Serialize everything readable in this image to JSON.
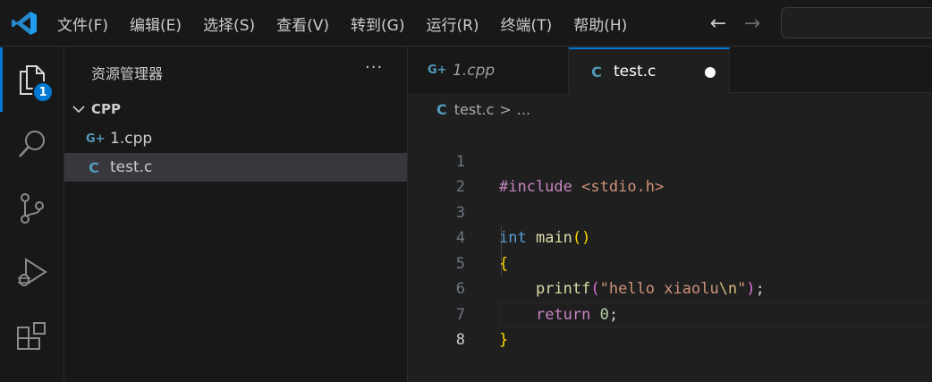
{
  "menu": [
    "文件(F)",
    "编辑(E)",
    "选择(S)",
    "查看(V)",
    "转到(G)",
    "运行(R)",
    "终端(T)",
    "帮助(H)"
  ],
  "activity": {
    "explorer_badge": "1",
    "items": [
      "explorer-icon",
      "search-icon",
      "source-control-icon",
      "run-debug-icon",
      "extensions-icon"
    ]
  },
  "sidebar": {
    "title": "资源管理器",
    "more": "···",
    "folder": "CPP",
    "files": [
      {
        "icon": "G+",
        "name": "1.cpp"
      },
      {
        "icon": "C",
        "name": "test.c"
      }
    ]
  },
  "tabs": [
    {
      "icon": "G+",
      "label": "1.cpp"
    },
    {
      "icon": "C",
      "label": "test.c"
    }
  ],
  "breadcrumb": {
    "icon": "C",
    "file": "test.c",
    "sep": ">",
    "more": "..."
  },
  "editor": {
    "line_numbers": [
      "1",
      "2",
      "3",
      "4",
      "5",
      "6",
      "7",
      "8"
    ],
    "code": {
      "l1_directive": "#include",
      "l1_header": "<stdio.h>",
      "l3_type": "int",
      "l3_fn": "main",
      "l3_parens": "()",
      "l4_brace": "{",
      "l5_indent": "    ",
      "l5_fn": "printf",
      "l5_open": "(",
      "l5_str_a": "\"hello xiaolu",
      "l5_esc": "\\n",
      "l5_str_b": "\"",
      "l5_close": ")",
      "l5_semi": ";",
      "l6_indent": "    ",
      "l6_kw": "return",
      "l6_num": "0",
      "l6_semi": ";",
      "l7_brace": "}"
    }
  },
  "colors": {
    "accent": "#0078d4",
    "c_icon": "#519aba",
    "keyword": "#c586c0",
    "string": "#ce9178",
    "type": "#569cd6",
    "function": "#dcdcaa",
    "brace": "#ffd700"
  }
}
